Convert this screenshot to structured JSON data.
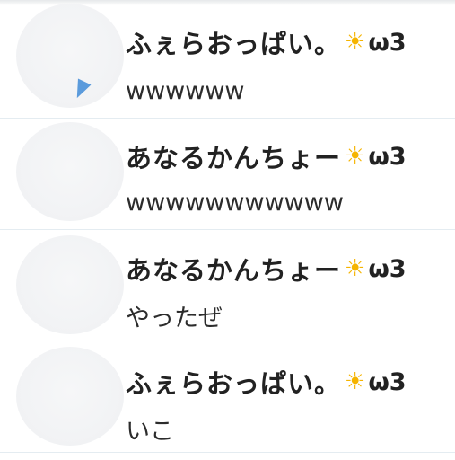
{
  "messages": [
    {
      "name": "ふぇらおっぱい。",
      "text": "wwwwww"
    },
    {
      "name": "あなるかんちょー",
      "text": "wwwwwwwwwww"
    },
    {
      "name": "あなるかんちょー",
      "text": "やったぜ"
    },
    {
      "name": "ふぇらおっぱい。",
      "text": "いこ"
    }
  ],
  "name_suffix": {
    "icon": "sun-icon",
    "glyph": "☀",
    "text": "ω3"
  },
  "colors": {
    "name_text": "#222222",
    "message_text": "#2c2c2c",
    "sun_icon": "#f5b400",
    "divider": "#e4ecf1"
  }
}
